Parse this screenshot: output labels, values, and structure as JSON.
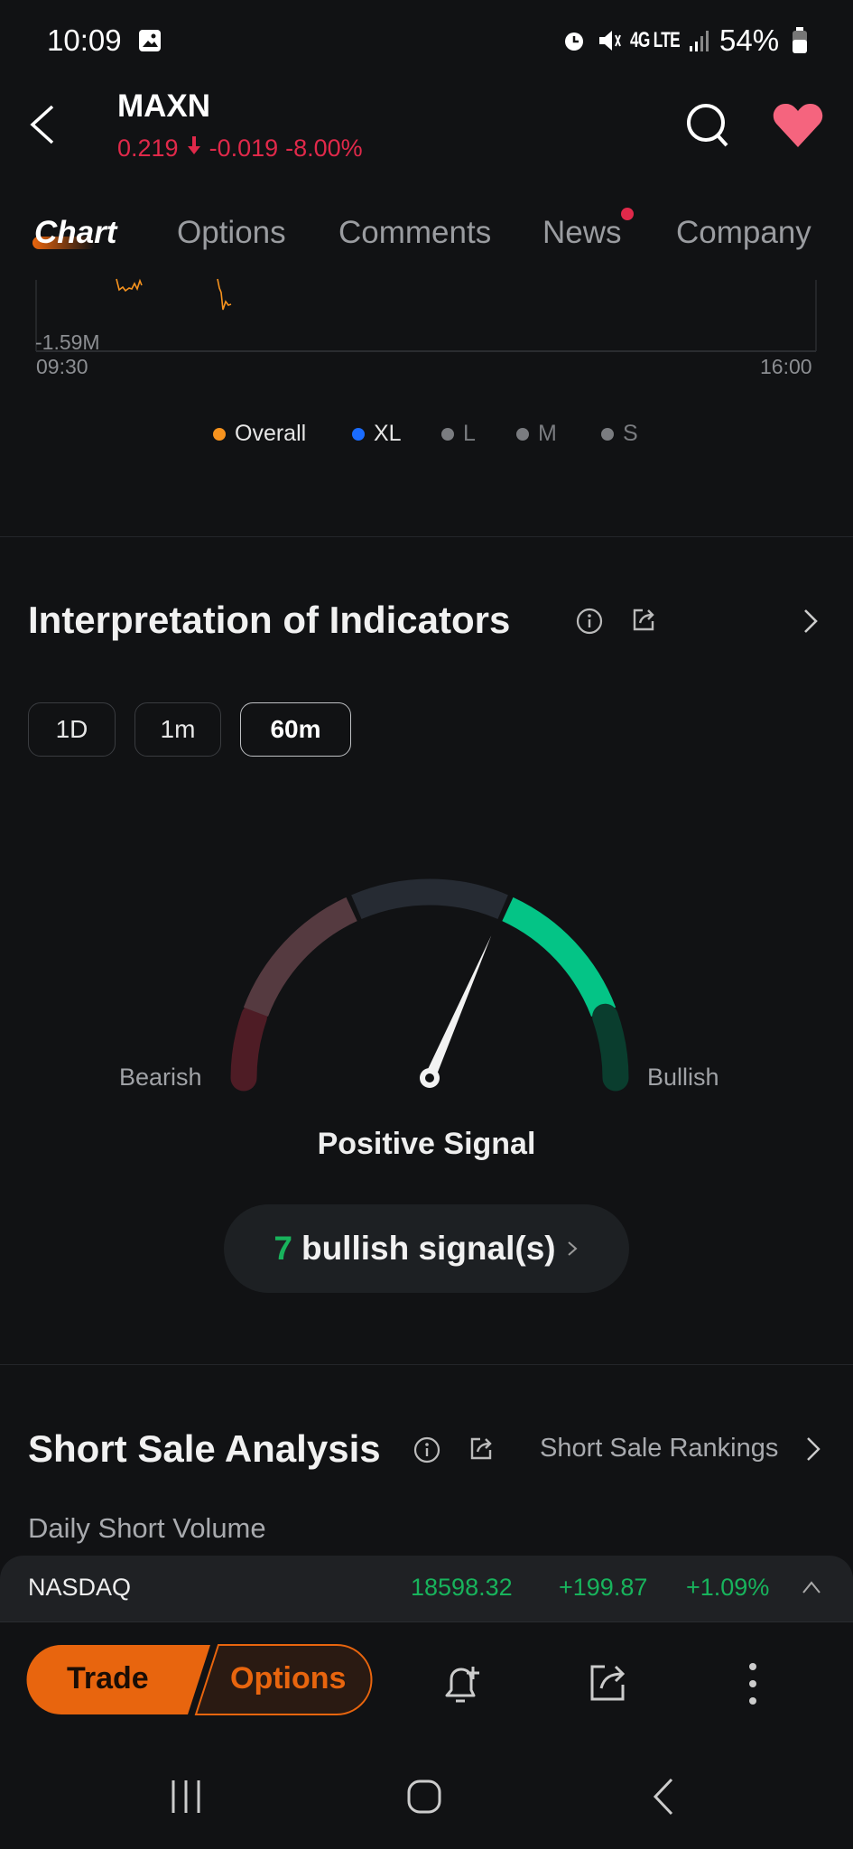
{
  "status_bar": {
    "time": "10:09",
    "battery": "54%",
    "network": "4G LTE"
  },
  "header": {
    "symbol": "MAXN",
    "price": "0.219",
    "change": "-0.019",
    "change_pct": "-8.00%",
    "price_color": "#e0294a",
    "favorite": true
  },
  "tabs": [
    {
      "label": "Chart",
      "active": true
    },
    {
      "label": "Options"
    },
    {
      "label": "Comments"
    },
    {
      "label": "News",
      "badge": true
    },
    {
      "label": "Company"
    }
  ],
  "chart_data": {
    "type": "line",
    "y_tick_labels": [
      "-1.59M"
    ],
    "x_tick_labels": [
      "09:30",
      "16:00"
    ],
    "legend": [
      {
        "label": "Overall",
        "color": "#f7931e"
      },
      {
        "label": "XL",
        "color": "#1a6cff"
      },
      {
        "label": "L",
        "color": "#7a7c80"
      },
      {
        "label": "M",
        "color": "#7a7c80"
      },
      {
        "label": "S",
        "color": "#7a7c80"
      }
    ]
  },
  "indicators": {
    "title": "Interpretation of Indicators",
    "periods": [
      "1D",
      "1m",
      "60m"
    ],
    "active_period": "60m",
    "gauge": {
      "left_label": "Bearish",
      "right_label": "Bullish",
      "needle_position": 0.63,
      "segment_colors": [
        "#4e1c25",
        "#553a40",
        "#262b33",
        "#04c486",
        "#0a3d2e"
      ]
    },
    "signal": "Positive Signal",
    "bullish_count": "7",
    "bullish_label": "bullish signal(s)",
    "count_color": "#18b35c"
  },
  "short_sale": {
    "title": "Short Sale Analysis",
    "rankings_link": "Short Sale Rankings",
    "subtitle": "Daily Short Volume"
  },
  "ticker": {
    "name": "NASDAQ",
    "value": "18598.32",
    "change": "+199.87",
    "change_pct": "+1.09%",
    "color": "#18b35c"
  },
  "bottom_bar": {
    "trade": "Trade",
    "options": "Options",
    "accent": "#e8650e"
  }
}
